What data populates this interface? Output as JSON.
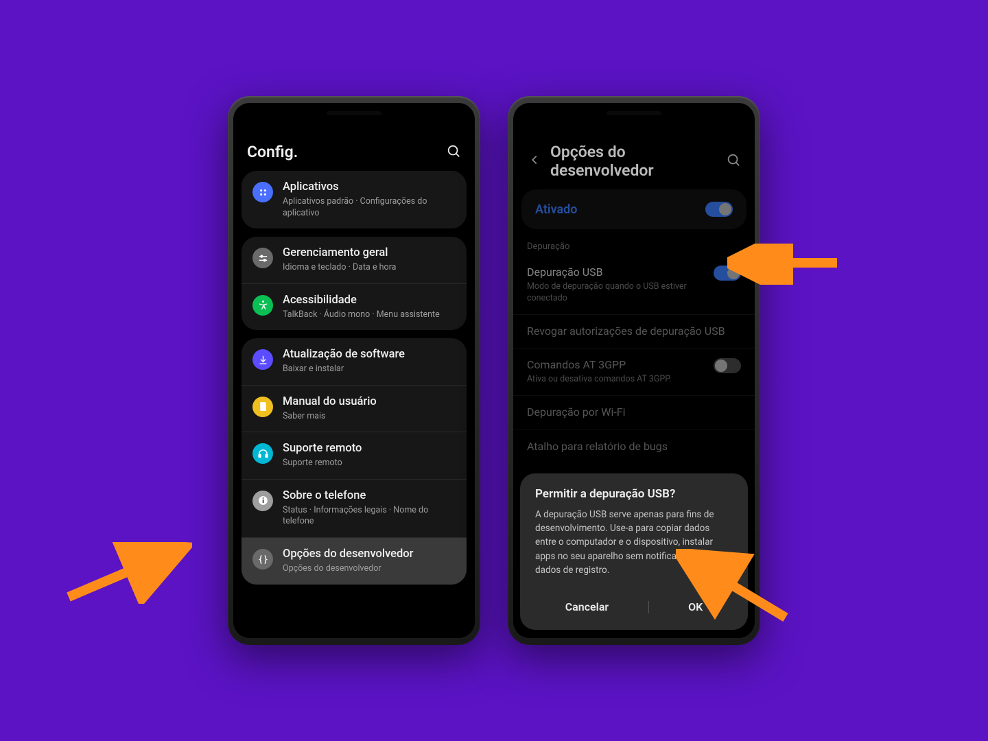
{
  "left": {
    "header": {
      "title": "Config."
    },
    "groups": [
      {
        "rows": [
          {
            "key": "apps",
            "icon": "apps-icon",
            "title": "Aplicativos",
            "sub": "Aplicativos padrão · Configurações do aplicativo",
            "color": "#4a6fff"
          }
        ]
      },
      {
        "rows": [
          {
            "key": "general",
            "icon": "sliders-icon",
            "title": "Gerenciamento geral",
            "sub": "Idioma e teclado · Data e hora",
            "color": "#6a6a6a"
          },
          {
            "key": "accessibility",
            "icon": "accessibility-icon",
            "title": "Acessibilidade",
            "sub": "TalkBack · Áudio mono · Menu assistente",
            "color": "#0abf53"
          }
        ]
      },
      {
        "rows": [
          {
            "key": "software-update",
            "icon": "download-icon",
            "title": "Atualização de software",
            "sub": "Baixar e instalar",
            "color": "#5b4dff"
          },
          {
            "key": "manual",
            "icon": "book-icon",
            "title": "Manual do usuário",
            "sub": "Saber mais",
            "color": "#f0c020"
          },
          {
            "key": "remote-support",
            "icon": "headset-icon",
            "title": "Suporte remoto",
            "sub": "Suporte remoto",
            "color": "#00b8d4"
          },
          {
            "key": "about-phone",
            "icon": "info-icon",
            "title": "Sobre o telefone",
            "sub": "Status · Informações legais · Nome do telefone",
            "color": "#9e9e9e"
          },
          {
            "key": "dev-options",
            "icon": "braces-icon",
            "title": "Opções do desenvolvedor",
            "sub": "Opções do desenvolvedor",
            "color": "#6a6a6a",
            "highlight": true
          }
        ]
      }
    ]
  },
  "right": {
    "header": {
      "title": "Opções do desenvolvedor"
    },
    "enabled": {
      "label": "Ativado",
      "on": true
    },
    "section_debug": "Depuração",
    "rows": [
      {
        "key": "usb-debug",
        "title": "Depuração USB",
        "sub": "Modo de depuração quando o USB estiver conectado",
        "toggle": "on"
      },
      {
        "key": "revoke-usb",
        "title": "Revogar autorizações de depuração USB",
        "sub": ""
      },
      {
        "key": "at-3gpp",
        "title": "Comandos AT 3GPP",
        "sub": "Ativa ou desativa comandos AT 3GPP.",
        "toggle": "off"
      },
      {
        "key": "wifi-debug",
        "title": "Depuração por Wi-Fi",
        "sub": ""
      },
      {
        "key": "bug-report-shortcut",
        "title": "Atalho para relatório de bugs",
        "sub": ""
      }
    ],
    "dialog": {
      "title": "Permitir a depuração USB?",
      "body": "A depuração USB serve apenas para fins de desenvolvimento. Use-a para copiar dados entre o computador e o dispositivo, instalar apps no seu aparelho sem notificação e ler dados de registro.",
      "cancel": "Cancelar",
      "ok": "OK"
    }
  }
}
